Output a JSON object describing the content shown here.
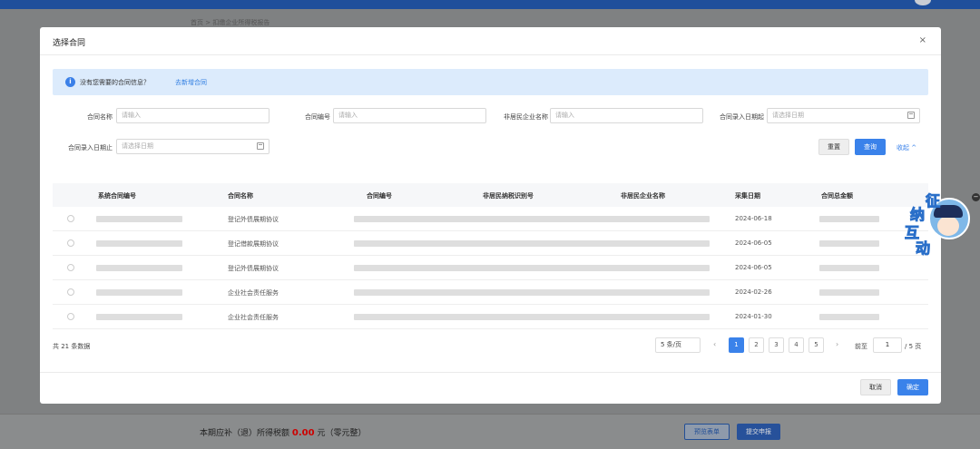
{
  "background": {
    "breadcrumb": "首页 > 扣缴企业所得税报告",
    "footer": {
      "label_prefix": "本期应补（退）所得税额",
      "amount": "0.00",
      "label_suffix": "元（零元整）",
      "btn_preview": "预览表单",
      "btn_submit": "提交申报"
    }
  },
  "modal": {
    "title": "选择合同",
    "close": "×",
    "alert": {
      "icon": "i",
      "text": "没有您需要的合同信息？",
      "link": "去新增合同"
    },
    "filters": {
      "contract_name": {
        "label": "合同名称",
        "placeholder": "请输入"
      },
      "contract_no": {
        "label": "合同编号",
        "placeholder": "请输入"
      },
      "company_name": {
        "label": "非居民企业名称",
        "placeholder": "请输入"
      },
      "date_from": {
        "label": "合同录入日期起",
        "placeholder": "请选择日期"
      },
      "date_to": {
        "label": "合同录入日期止",
        "placeholder": "请选择日期"
      }
    },
    "actions": {
      "reset": "重置",
      "query": "查询",
      "collapse": "收起 ^"
    },
    "table": {
      "columns": [
        "系统合同编号",
        "合同名称",
        "合同编号",
        "非居民纳税识别号",
        "非居民企业名称",
        "采集日期",
        "合同总金额"
      ],
      "rows": [
        {
          "name": "登记外债展期协议",
          "date": "2024-06-18"
        },
        {
          "name": "登记借款展期协议",
          "date": "2024-06-05"
        },
        {
          "name": "登记外债展期协议",
          "date": "2024-06-05"
        },
        {
          "name": "企业社会责任服务",
          "date": "2024-02-26"
        },
        {
          "name": "企业社会责任服务",
          "date": "2024-01-30"
        }
      ]
    },
    "pagination": {
      "total": "共 21 条数据",
      "page_size": "5 条/页",
      "pages": [
        "1",
        "2",
        "3",
        "4",
        "5"
      ],
      "current_page": "1",
      "prev": "‹",
      "next": "›",
      "jump_label": "前至",
      "jump_value": "1",
      "jump_total": "/ 5 页"
    },
    "footer": {
      "cancel": "取消",
      "ok": "确定"
    }
  },
  "assistant": {
    "chars": [
      "征",
      "纳",
      "互",
      "动"
    ],
    "collapse": "−"
  },
  "colors": {
    "primary": "#3a82ea",
    "alert_bg": "#dcebfc",
    "topbar": "#1f4f9b"
  }
}
